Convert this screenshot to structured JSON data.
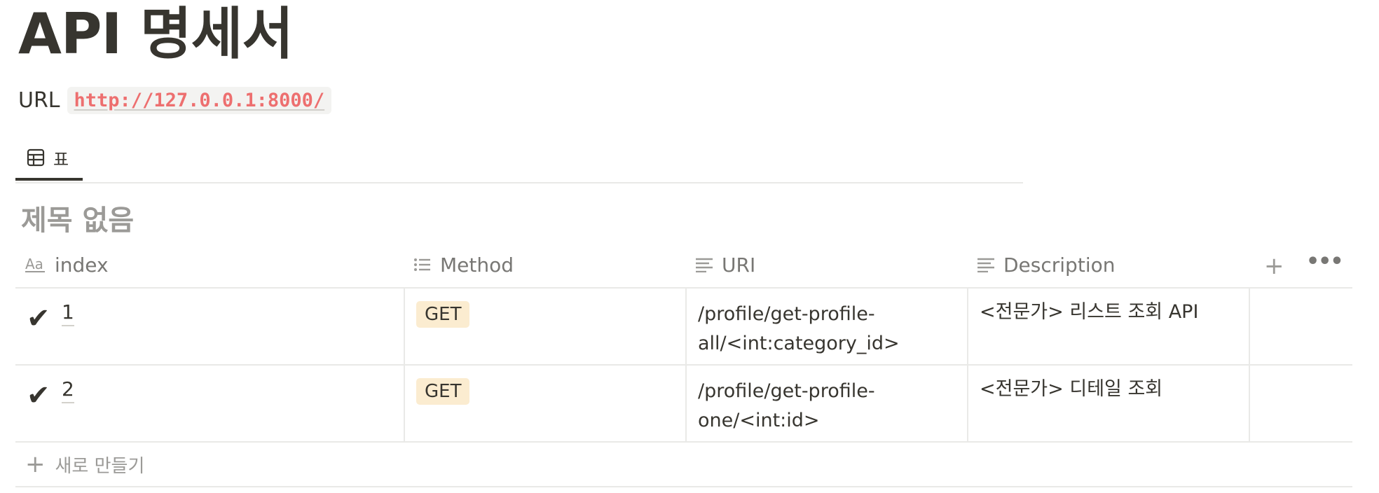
{
  "page": {
    "title": "API 명세서",
    "url_label": "URL",
    "url_value": "http://127.0.0.1:8000/"
  },
  "view_tabs": [
    {
      "icon": "table-icon",
      "label": "표",
      "active": true
    }
  ],
  "database": {
    "title": "제목 없음",
    "columns": [
      {
        "icon": "title-aa-icon",
        "label": "index"
      },
      {
        "icon": "list-icon",
        "label": "Method"
      },
      {
        "icon": "text-lines-icon",
        "label": "URI"
      },
      {
        "icon": "text-lines-icon",
        "label": "Description"
      }
    ],
    "add_column_icon": "+",
    "more_icon": "•••",
    "rows": [
      {
        "check": "✔",
        "index": "1",
        "method": "GET",
        "uri_line1": "/profile/get-profile-",
        "uri_line2": "all/<int:category_id>",
        "description": "<전문가> 리스트 조회 API"
      },
      {
        "check": "✔",
        "index": "2",
        "method": "GET",
        "uri_line1": "/profile/get-profile-",
        "uri_line2": "one/<int:id>",
        "description": "<전문가> 디테일 조회"
      }
    ],
    "new_row_icon": "+",
    "new_row_label": "새로 만들기"
  },
  "colors": {
    "text": "#37352f",
    "muted": "#9b9a97",
    "code_red": "#eb5757",
    "tag_bg": "#fbecd0",
    "border": "#e9e9e7"
  }
}
